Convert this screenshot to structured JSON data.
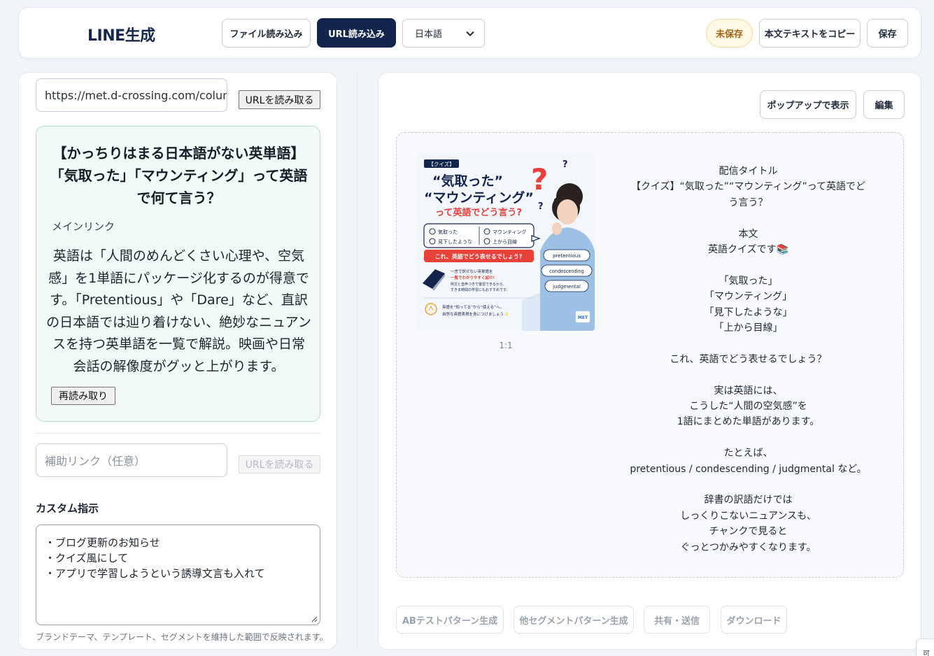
{
  "header": {
    "app_title": "LINE生成",
    "file_import": "ファイル読み込み",
    "url_import": "URL読み込み",
    "language": "日本語",
    "unsaved": "未保存",
    "copy_text": "本文テキストをコピー",
    "save": "保存"
  },
  "left": {
    "url_value": "https://met.d-crossing.com/column/",
    "read_url": "URLを読み取る",
    "preview": {
      "title": "【かっちりはまる日本語がない英単語】「気取った」「マウンティング」って英語で何て言う？",
      "sub_label": "メインリンク",
      "description": "英語は「人間のめんどくさい心理や、空気感」を1単語にパッケージ化するのが得意です。「Pretentious」や「Dare」など、直訳の日本語では辿り着けない、絶妙なニュアンスを持つ英単語を一覧で解説。映画や日常会話の解像度がグッと上がります。",
      "reread": "再読み取り"
    },
    "aux_placeholder": "補助リンク（任意）",
    "aux_read": "URLを読み取る",
    "custom_label": "カスタム指示",
    "custom_lines": [
      "・ブログ更新のお知らせ",
      "・クイズ風にして",
      "・アプリで学習しようという誘導文言も入れて"
    ],
    "hint": "ブランドテーマ、テンプレート、セグメントを維持した範囲で反映されます。"
  },
  "right": {
    "popup": "ポップアップで表示",
    "edit": "編集",
    "ratio": "1:1",
    "thumbnail": {
      "tag": "【クイズ】",
      "line1": "“気取った”",
      "line2": "“マウンティング”",
      "line3": "って英語でどう言う?",
      "items": [
        "気取った",
        "マウンティング",
        "見下したような",
        "上から目線"
      ],
      "banner": "これ、英語でどう表せるでしょう?",
      "note_lines": [
        "一言で訳せない英単語を",
        "一覧でわかりやすく紹介!",
        "例文と音声つきで復習できるから、",
        "すきま時間の学習にもおすすめです。"
      ],
      "bottom_lines": [
        "英語を“知ってる”から“使える”へ。",
        "自然な英語表現を身につけましょう✨"
      ],
      "bubbles": [
        "pretentious",
        "condescending",
        "judgmental"
      ],
      "logo": "MET"
    },
    "message_lines": [
      "配信タイトル",
      "【クイズ】“気取った”“マウンティング”って英語でど",
      "う言う？",
      "",
      "本文",
      "英語クイズです📚",
      "",
      "「気取った」",
      "「マウンティング」",
      "「見下したような」",
      "「上から目線」",
      "",
      "これ、英語でどう表せるでしょう？",
      "",
      "実は英語には、",
      "こうした“人間の空気感”を",
      "1語にまとめた単語があります。",
      "",
      "たとえば、",
      "pretentious / condescending / judgmental など。",
      "",
      "辞書の訳語だけでは",
      "しっくりこないニュアンスも、",
      "チャンクで見ると",
      "ぐっとつかみやすくなります。"
    ],
    "actions": [
      "ABテストパターン生成",
      "他セグメントパターン生成",
      "共有・送信",
      "ダウンロード"
    ]
  },
  "corner_tab": "可",
  "colors": {
    "accent": "#13254d",
    "unsaved_bg": "#fff8e4",
    "preview_bg": "#f2faf8",
    "thumb_red": "#e8413a"
  }
}
